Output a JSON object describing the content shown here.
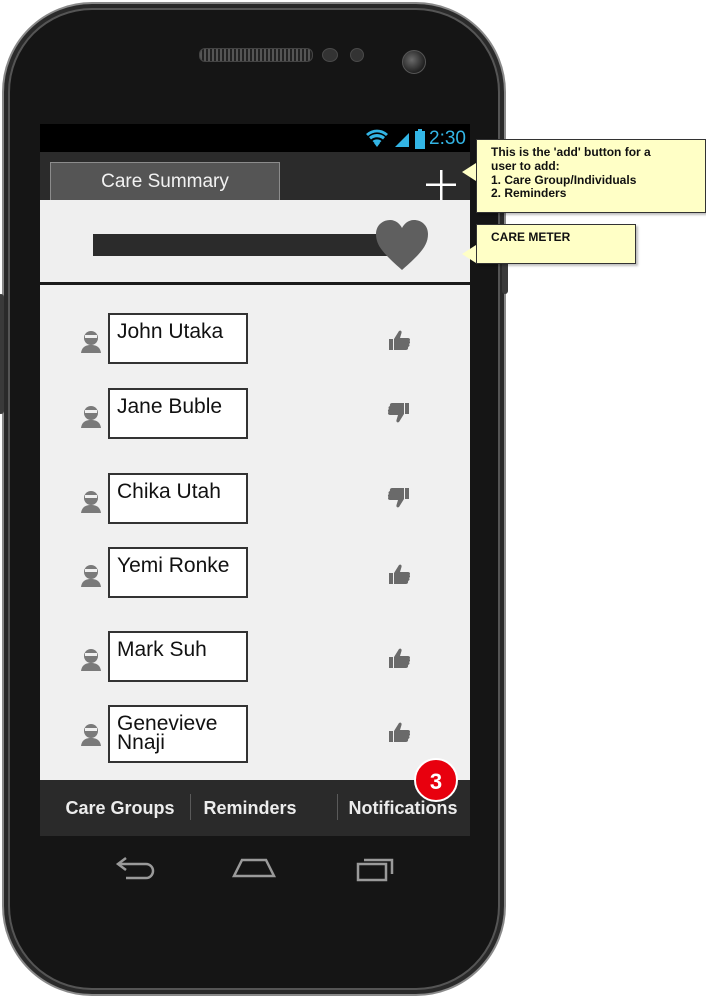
{
  "status_bar": {
    "time": "2:30"
  },
  "header": {
    "tab_label": "Care Summary",
    "add_icon": "plus-icon"
  },
  "care_meter": {
    "level": 0.98,
    "icon": "heart-icon"
  },
  "contacts": [
    {
      "name": "John Utaka",
      "feedback": "thumbs-up"
    },
    {
      "name": "Jane Buble",
      "feedback": "thumbs-down"
    },
    {
      "name": "Chika Utah",
      "feedback": "thumbs-down"
    },
    {
      "name": "Yemi Ronke",
      "feedback": "thumbs-up"
    },
    {
      "name": "Mark Suh",
      "feedback": "thumbs-up"
    },
    {
      "name_line1": "Genevieve",
      "name_line2": "Nnaji",
      "feedback": "thumbs-up"
    }
  ],
  "bottom_nav": {
    "care_groups": "Care Groups",
    "reminders": "Reminders",
    "notifications": "Notifications",
    "notification_count": "3"
  },
  "callouts": {
    "add_button": {
      "line1": "This is the 'add' button for a",
      "line2": "user to add:",
      "line3": "1. Care Group/Individuals",
      "line4": "2. Reminders"
    },
    "care_meter": "CARE METER"
  },
  "colors": {
    "accent_status": "#33b5e5",
    "badge": "#e8000e",
    "callout_bg": "#ffffc6",
    "list_bg": "#f0f0f0"
  }
}
